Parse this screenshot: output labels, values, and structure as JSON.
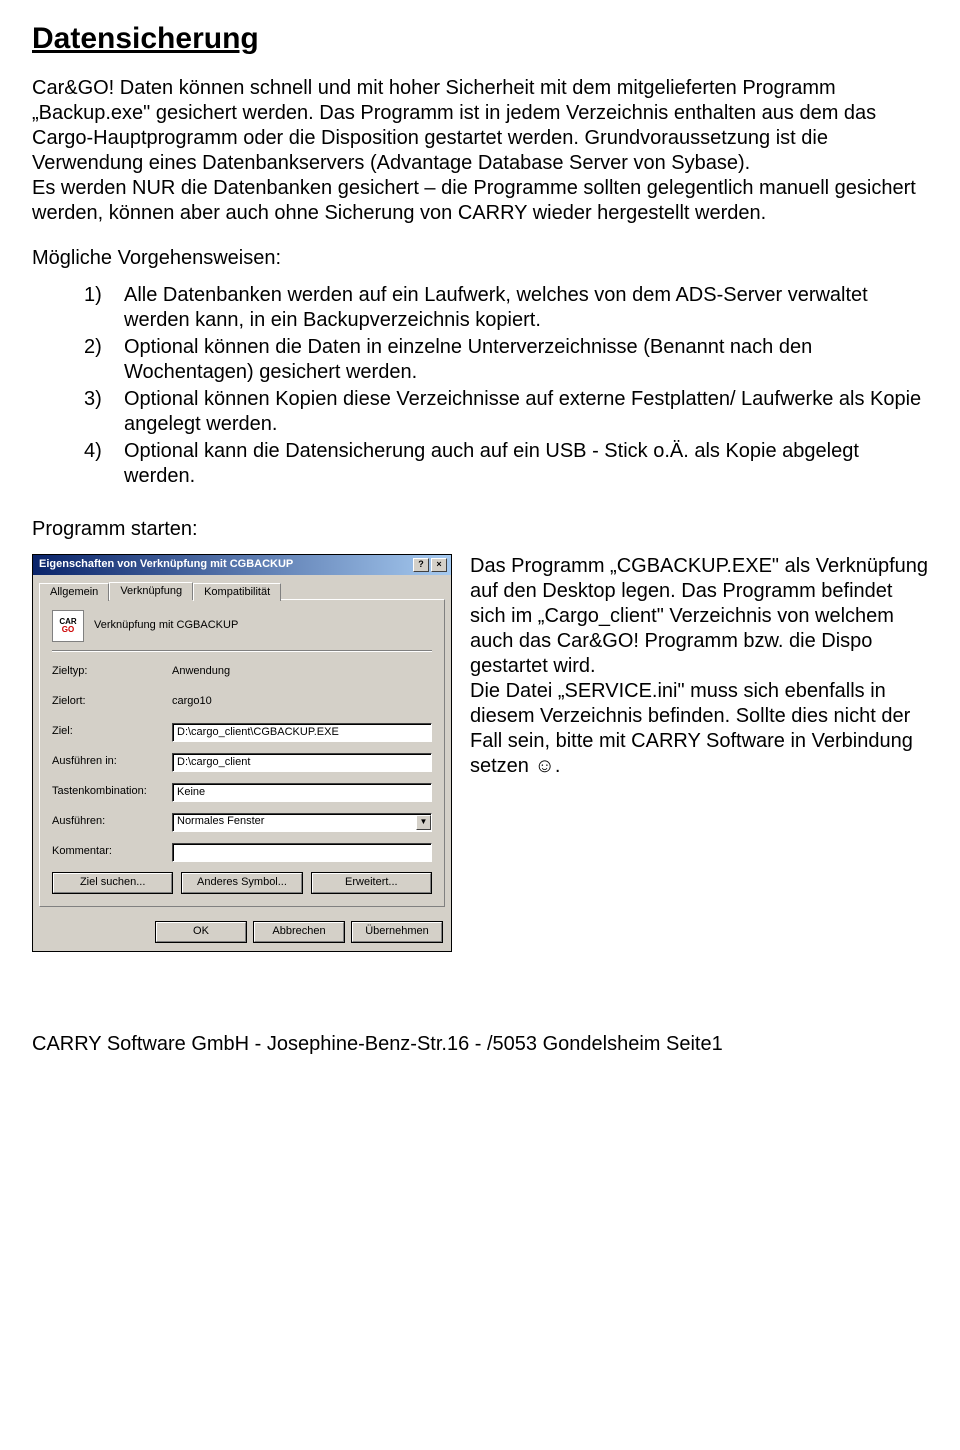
{
  "title": "Datensicherung",
  "intro": "Car&GO! Daten können schnell und mit hoher Sicherheit mit dem mitgelieferten Programm „Backup.exe\" gesichert werden. Das Programm ist in jedem Verzeichnis enthalten aus dem das Cargo-Hauptprogramm oder die Disposition gestartet werden. Grundvoraussetzung ist die Verwendung eines Datenbankservers (Advantage Database Server von Sybase).\nEs werden NUR die Datenbanken gesichert – die Programme sollten gelegentlich manuell gesichert werden, können aber auch ohne Sicherung von CARRY wieder hergestellt werden.",
  "approaches_heading": "Mögliche Vorgehensweisen:",
  "approaches": [
    "Alle Datenbanken werden auf ein Laufwerk, welches von dem ADS-Server verwaltet werden kann, in ein Backupverzeichnis kopiert.",
    "Optional können die Daten in einzelne Unterverzeichnisse (Benannt nach den Wochentagen) gesichert werden.",
    "Optional können Kopien diese Verzeichnisse auf externe Festplatten/ Laufwerke als Kopie angelegt werden.",
    "Optional kann die Datensicherung auch auf ein USB - Stick o.Ä. als Kopie abgelegt werden."
  ],
  "start_heading": "Programm starten:",
  "dialog": {
    "title": "Eigenschaften von Verknüpfung mit CGBACKUP",
    "tabs": [
      "Allgemein",
      "Verknüpfung",
      "Kompatibilität"
    ],
    "link_name": "Verknüpfung mit CGBACKUP",
    "fields": {
      "zieltyp_label": "Zieltyp:",
      "zieltyp_value": "Anwendung",
      "zielort_label": "Zielort:",
      "zielort_value": "cargo10",
      "ziel_label": "Ziel:",
      "ziel_value": "D:\\cargo_client\\CGBACKUP.EXE",
      "ausfuehren_in_label": "Ausführen in:",
      "ausfuehren_in_value": "D:\\cargo_client",
      "tasten_label": "Tastenkombination:",
      "tasten_value": "Keine",
      "ausfuehren_label": "Ausführen:",
      "ausfuehren_value": "Normales Fenster",
      "kommentar_label": "Kommentar:",
      "kommentar_value": ""
    },
    "buttons": {
      "ziel_suchen": "Ziel suchen...",
      "anderes_symbol": "Anderes Symbol...",
      "erweitert": "Erweitert...",
      "ok": "OK",
      "abbrechen": "Abbrechen",
      "uebernehmen": "Übernehmen"
    }
  },
  "side_text": "Das Programm „CGBACKUP.EXE\" als Verknüpfung auf den Desktop legen. Das Programm befindet sich im „Cargo_client\" Verzeichnis von welchem auch das Car&GO! Programm bzw. die Dispo gestartet wird.\nDie Datei „SERVICE.ini\" muss sich ebenfalls in diesem Verzeichnis befinden. Sollte dies nicht der Fall sein, bitte mit CARRY Software in Verbindung setzen ☺.",
  "footer": "CARRY Software GmbH - Josephine-Benz-Str.16 - /5053 Gondelsheim   Seite1"
}
